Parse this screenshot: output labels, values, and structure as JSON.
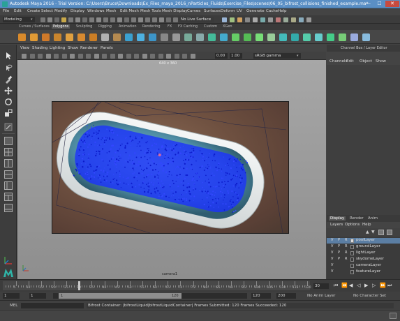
{
  "window": {
    "title": "Autodesk Maya 2016 - Trial Version: C:\\Users\\Bruce\\Downloads\\Ex_Files_maya_2016_nParticles_Fluids\\Exercise_Files\\scenes\\06_05_bifrost_collisions_finished_example.ma*",
    "minimize": "—",
    "maximize": "☐",
    "close": "✕"
  },
  "menubar": [
    "File",
    "Edit",
    "Create",
    "Select",
    "Modify",
    "Display",
    "Windows",
    "Mesh",
    "Edit Mesh",
    "Mesh Tools",
    "Mesh Display",
    "Curves",
    "Surfaces",
    "Deform",
    "UV",
    "Generate",
    "Cache",
    "Help"
  ],
  "statusline": {
    "mode": "Modeling",
    "live_surface": "No Live Surface"
  },
  "shelf_tabs": {
    "items": [
      "Curves / Surfaces",
      "Polygons",
      "Sculpting",
      "Rigging",
      "Animation",
      "Rendering",
      "FX",
      "FX Caching",
      "Custom",
      "XGen"
    ],
    "active_index": 1
  },
  "viewport": {
    "menu": [
      "View",
      "Shading",
      "Lighting",
      "Show",
      "Renderer",
      "Panels"
    ],
    "resolution_label": "640 x 360",
    "gamma_value": "0.00",
    "gamma_scale": "1.00",
    "color_space": "sRGB gamma",
    "camera_label": "camera1"
  },
  "channel_box": {
    "tab_label": "Channel Box / Layer Editor",
    "menu": [
      "Channels",
      "Edit",
      "Object",
      "Show"
    ]
  },
  "layer_editor": {
    "tabs": [
      "Display",
      "Render",
      "Anim"
    ],
    "active_tab": 0,
    "menu": [
      "Layers",
      "Options",
      "Help"
    ],
    "layers": [
      {
        "v": "V",
        "p": "P",
        "r": "R",
        "name": "poolLayer",
        "checked": true,
        "selected": true
      },
      {
        "v": "V",
        "p": "P",
        "r": "R",
        "name": "groundLayer",
        "checked": false,
        "selected": false
      },
      {
        "v": "V",
        "p": "P",
        "r": "R",
        "name": "lightLayer",
        "checked": false,
        "selected": false
      },
      {
        "v": "V",
        "p": "P",
        "r": "R",
        "name": "skydomeLayer",
        "checked": false,
        "selected": false
      },
      {
        "v": "V",
        "p": "",
        "r": "",
        "name": "cameraLayer",
        "checked": false,
        "selected": false
      },
      {
        "v": "V",
        "p": "",
        "r": "",
        "name": "featureLayer",
        "checked": false,
        "selected": false
      }
    ]
  },
  "timeline": {
    "ticks": [
      "5",
      "10",
      "15",
      "20",
      "25",
      "30",
      "35",
      "40",
      "45",
      "50",
      "55",
      "60",
      "65",
      "70",
      "75",
      "80",
      "85",
      "90",
      "95",
      "100",
      "105",
      "110",
      "115",
      "120"
    ],
    "current_frame": "30",
    "current_fraction": 0.24
  },
  "range": {
    "start": "1",
    "playback_start": "1",
    "range_start_label": "1",
    "range_end_label": "120",
    "playback_end": "120",
    "end": "200",
    "anim_layer": "No Anim Layer",
    "character_set": "No Character Set"
  },
  "cmdline": {
    "label": "MEL",
    "message": "Bifrost Container: |bifrostLiquid|bifrostLiquidContainer| Frames Submitted: 120 Frames Succeeded: 120"
  },
  "colors": {
    "accent": "#5a8fc5",
    "particles": "#1a2fff",
    "tub_interior": "#5c9cb5",
    "tub_rim": "#e8ecec"
  }
}
